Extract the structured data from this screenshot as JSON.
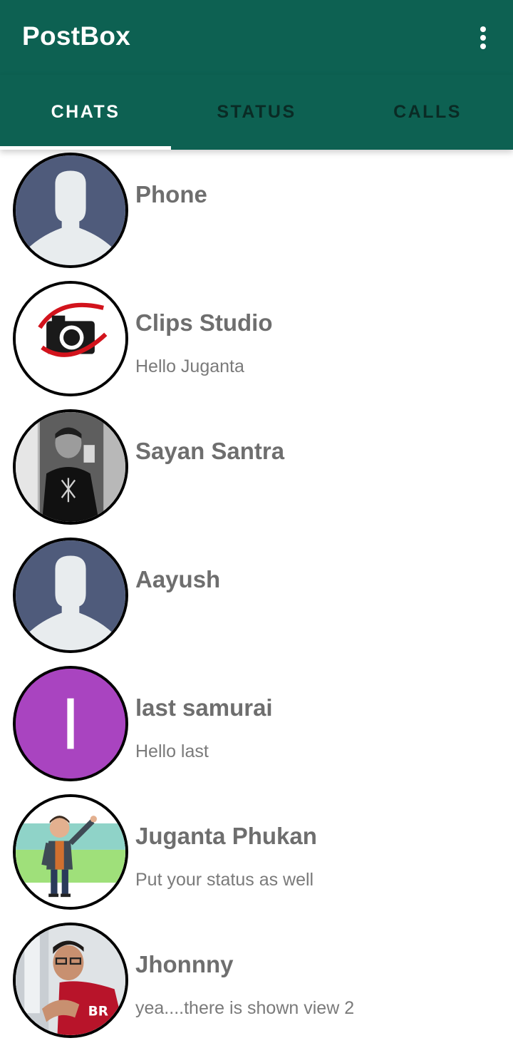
{
  "app": {
    "title": "PostBox"
  },
  "tabs": [
    {
      "label": "CHATS",
      "active": true
    },
    {
      "label": "STATUS",
      "active": false
    },
    {
      "label": "CALLS",
      "active": false
    }
  ],
  "chats": [
    {
      "name": "Phone",
      "last_message": "",
      "avatar": "default-person-icon"
    },
    {
      "name": "Clips Studio",
      "last_message": "Hello Juganta",
      "avatar": "camera-logo",
      "avatar_caption": "Clips Studio"
    },
    {
      "name": "Sayan Santra",
      "last_message": "",
      "avatar": "photo"
    },
    {
      "name": "Aayush",
      "last_message": "",
      "avatar": "default-person-icon"
    },
    {
      "name": "last samurai",
      "last_message": "Hello last",
      "avatar": "letter",
      "avatar_letter": "l"
    },
    {
      "name": "Juganta Phukan",
      "last_message": "Put your status as well",
      "avatar": "cartoon"
    },
    {
      "name": "Jhonnny",
      "last_message": "yea....there is shown view 2",
      "avatar": "photo"
    }
  ],
  "colors": {
    "primary": "#0d6152",
    "inactive_tab": "#0a2b25",
    "text_name": "#6e6e6e",
    "text_message": "#7a7a7a",
    "default_avatar_bg": "#4f5b7b",
    "default_avatar_fg": "#e8ecee",
    "letter_avatar_bg": "#a944c0"
  }
}
